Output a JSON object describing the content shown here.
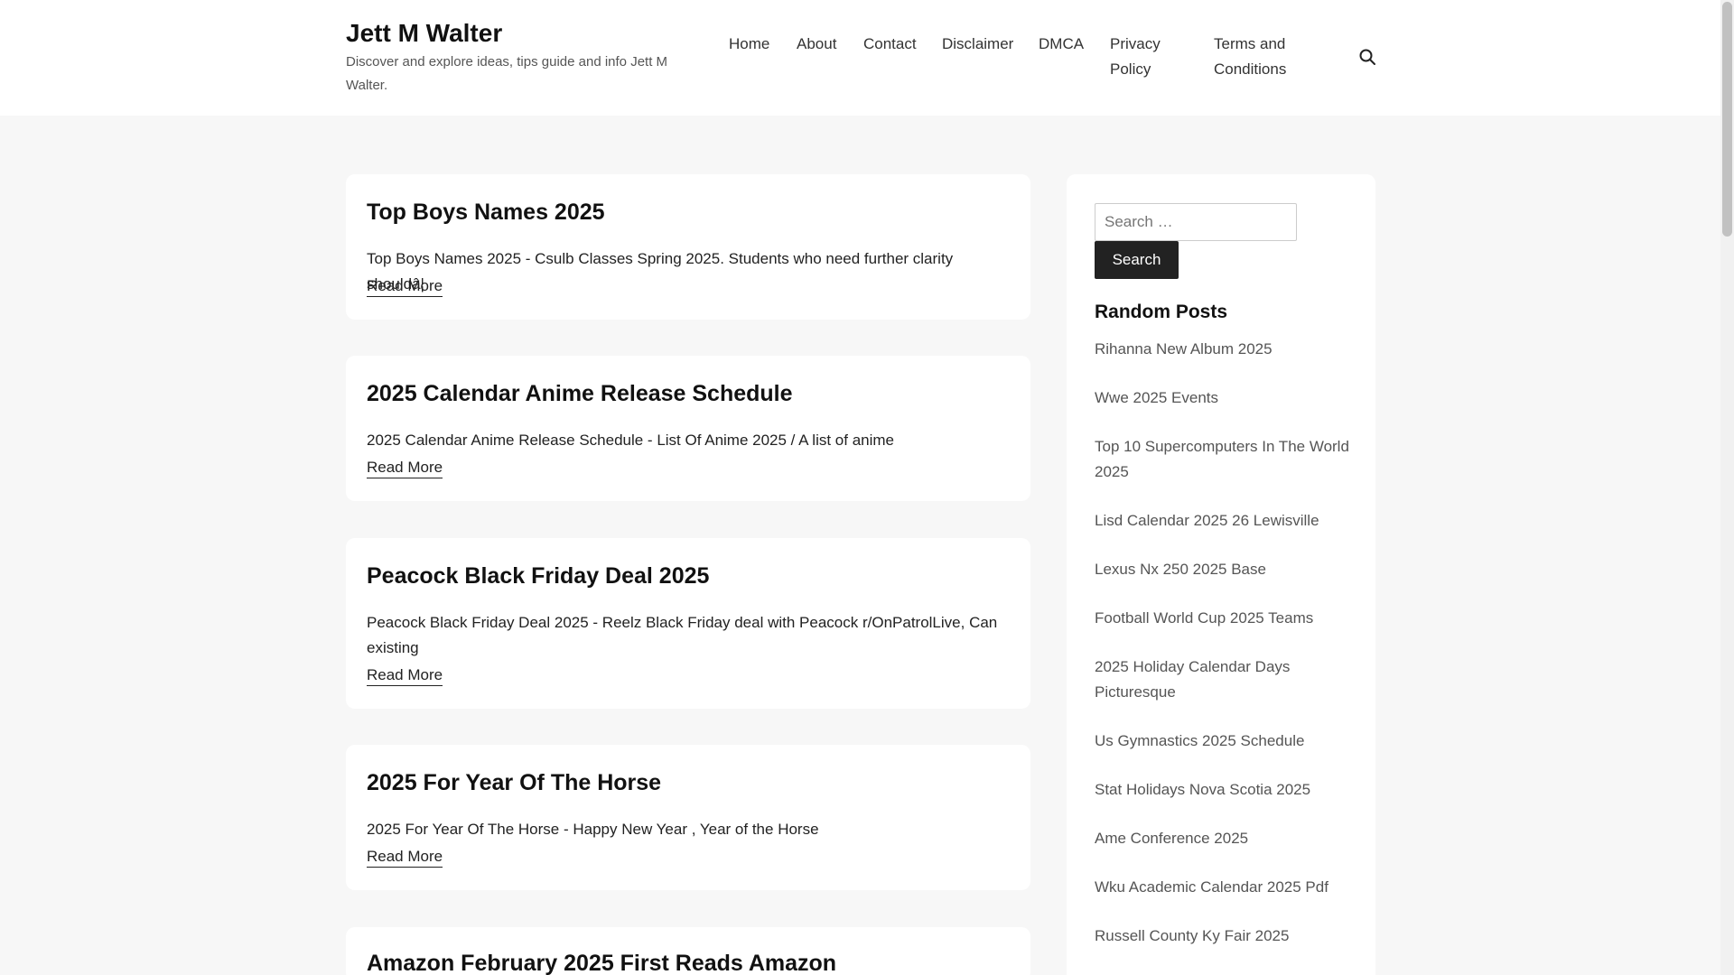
{
  "site": {
    "title": "Jett M Walter",
    "description": "Discover and explore ideas, tips guide and info Jett M Walter."
  },
  "nav": {
    "items": [
      "Home",
      "About",
      "Contact",
      "Disclaimer",
      "DMCA",
      "Privacy Policy",
      "Terms and Conditions"
    ],
    "search_icon": "search-icon"
  },
  "posts": [
    {
      "title": "Top Boys Names 2025",
      "excerpt": "Top Boys Names 2025 - Csulb Classes Spring 2025. Students who need further clarity shouldâ¦",
      "more": "Read More"
    },
    {
      "title": "2025 Calendar Anime Release Schedule",
      "excerpt": "2025 Calendar Anime Release Schedule - List Of Anime 2025 / A list of anime",
      "more": "Read More"
    },
    {
      "title": "Peacock Black Friday Deal 2025",
      "excerpt": "Peacock Black Friday Deal 2025 - Reelz Black Friday deal with Peacock r/OnPatrolLive, Can existing",
      "more": "Read More"
    },
    {
      "title": "2025 For Year Of The Horse",
      "excerpt": "2025 For Year Of The Horse - Happy New Year , Year of the Horse",
      "more": "Read More"
    },
    {
      "title": "Amazon February 2025 First Reads Amazon",
      "excerpt": "",
      "more": ""
    }
  ],
  "sidebar": {
    "search": {
      "placeholder": "Search …",
      "button": "Search"
    },
    "random_posts": {
      "title": "Random Posts",
      "items": [
        "Rihanna New Album 2025",
        "Wwe 2025 Events",
        "Top 10 Supercomputers In The World 2025",
        "Lisd Calendar 2025 26 Lewisville",
        "Lexus Nx 250 2025 Base",
        "Football World Cup 2025 Teams",
        "2025 Holiday Calendar Days Picturesque",
        "Us Gymnastics 2025 Schedule",
        "Stat Holidays Nova Scotia 2025",
        "Ame Conference 2025",
        "Wku Academic Calendar 2025 Pdf",
        "Russell County Ky Fair 2025"
      ]
    }
  },
  "colors": {
    "accent": "#222222",
    "background": "#f7f7f7"
  }
}
